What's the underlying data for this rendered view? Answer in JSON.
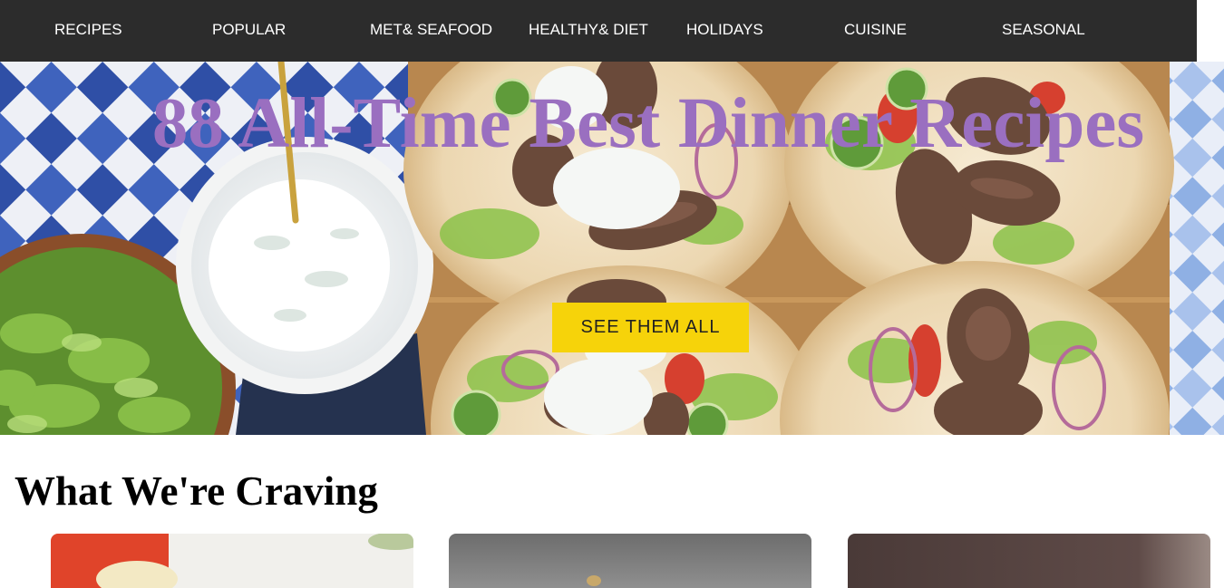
{
  "nav": {
    "items": [
      {
        "label": "RECIPES"
      },
      {
        "label": "POPULAR"
      },
      {
        "label": "MET& SEAFOOD"
      },
      {
        "label": "HEALTHY& DIET"
      },
      {
        "label": "HOLIDAYS"
      },
      {
        "label": "CUISINE"
      },
      {
        "label": "SEASONAL"
      }
    ]
  },
  "hero": {
    "title": "88 All-Time Best Dinner Recipes",
    "cta_label": "SEE THEM ALL",
    "title_color": "#9a6fc0",
    "cta_color": "#f6d30a"
  },
  "craving": {
    "heading": "What We're Craving",
    "cards": [
      {
        "image": "recipe-photo"
      },
      {
        "image": "recipe-photo"
      },
      {
        "image": "recipe-photo"
      }
    ]
  },
  "colors": {
    "nav_bg": "#2c2c2c",
    "nav_text": "#ffffff"
  }
}
